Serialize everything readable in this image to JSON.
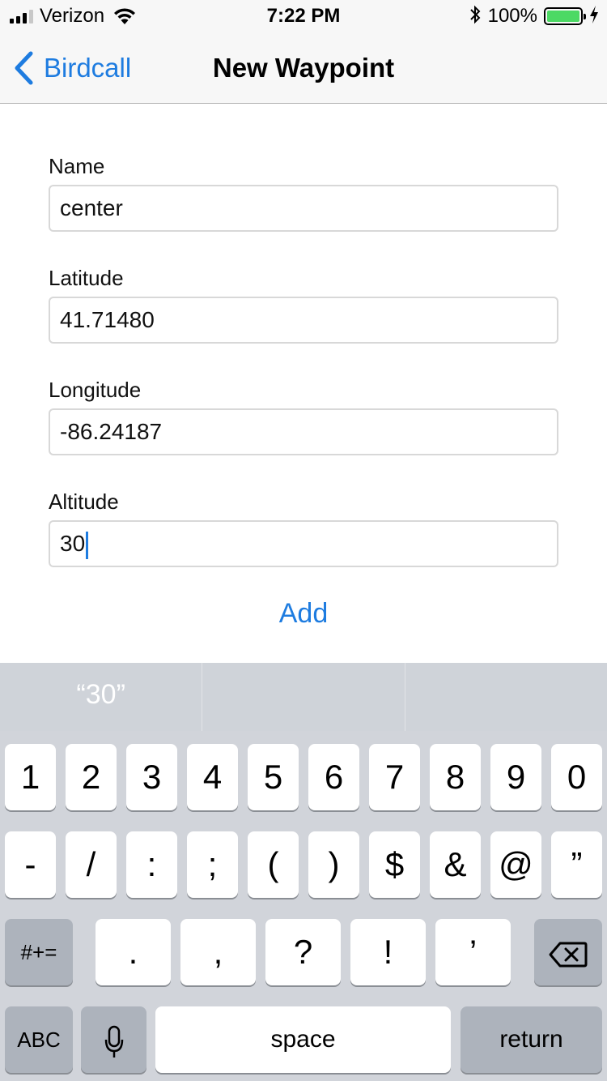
{
  "status_bar": {
    "carrier": "Verizon",
    "time": "7:22 PM",
    "battery_percent": "100%",
    "signal_bars_filled": 3,
    "signal_bars_total": 4,
    "battery_level": 1.0
  },
  "nav": {
    "back_label": "Birdcall",
    "title": "New Waypoint"
  },
  "form": {
    "fields": [
      {
        "label": "Name",
        "value": "center"
      },
      {
        "label": "Latitude",
        "value": "41.71480"
      },
      {
        "label": "Longitude",
        "value": "-86.24187"
      },
      {
        "label": "Altitude",
        "value": "30"
      }
    ],
    "add_label": "Add"
  },
  "keyboard": {
    "suggestions": [
      "“30”",
      "",
      ""
    ],
    "row1": [
      "1",
      "2",
      "3",
      "4",
      "5",
      "6",
      "7",
      "8",
      "9",
      "0"
    ],
    "row2": [
      "-",
      "/",
      ":",
      ";",
      "(",
      ")",
      "$",
      "&",
      "@",
      "”"
    ],
    "row3_symbols_label": "#+=",
    "row3": [
      ".",
      ",",
      "?",
      "!",
      "’"
    ],
    "abc_label": "ABC",
    "space_label": "space",
    "return_label": "return"
  },
  "colors": {
    "accent": "#1e7ce0",
    "battery_green": "#4cd964",
    "keyboard_bg": "#d1d4da"
  }
}
